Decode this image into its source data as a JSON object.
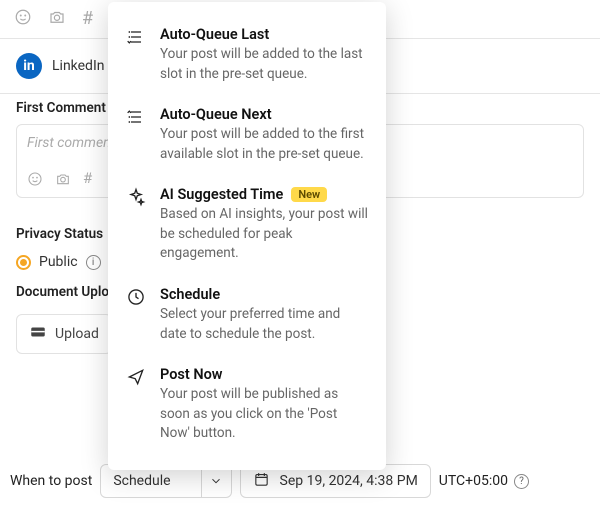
{
  "platform": {
    "name": "LinkedIn"
  },
  "first_comment": {
    "label": "First Comment",
    "placeholder": "First comment"
  },
  "privacy": {
    "label": "Privacy Status",
    "option": "Public"
  },
  "upload": {
    "label": "Document Upload",
    "button": "Upload"
  },
  "when": {
    "label": "When to post",
    "selected": "Schedule",
    "datetime": "Sep 19, 2024, 4:38 PM",
    "timezone": "UTC+05:00"
  },
  "menu": {
    "items": [
      {
        "title": "Auto-Queue Last",
        "desc": "Your post will be added to the last slot in the pre-set queue.",
        "badge": ""
      },
      {
        "title": "Auto-Queue Next",
        "desc": "Your post will be added to the first available slot in the pre-set queue.",
        "badge": ""
      },
      {
        "title": "AI Suggested Time",
        "desc": "Based on AI insights, your post will be scheduled for peak engagement.",
        "badge": "New"
      },
      {
        "title": "Schedule",
        "desc": "Select your preferred time and date to schedule the post.",
        "badge": ""
      },
      {
        "title": "Post Now",
        "desc": "Your post will be published as soon as you click on the 'Post Now' button.",
        "badge": ""
      }
    ]
  }
}
